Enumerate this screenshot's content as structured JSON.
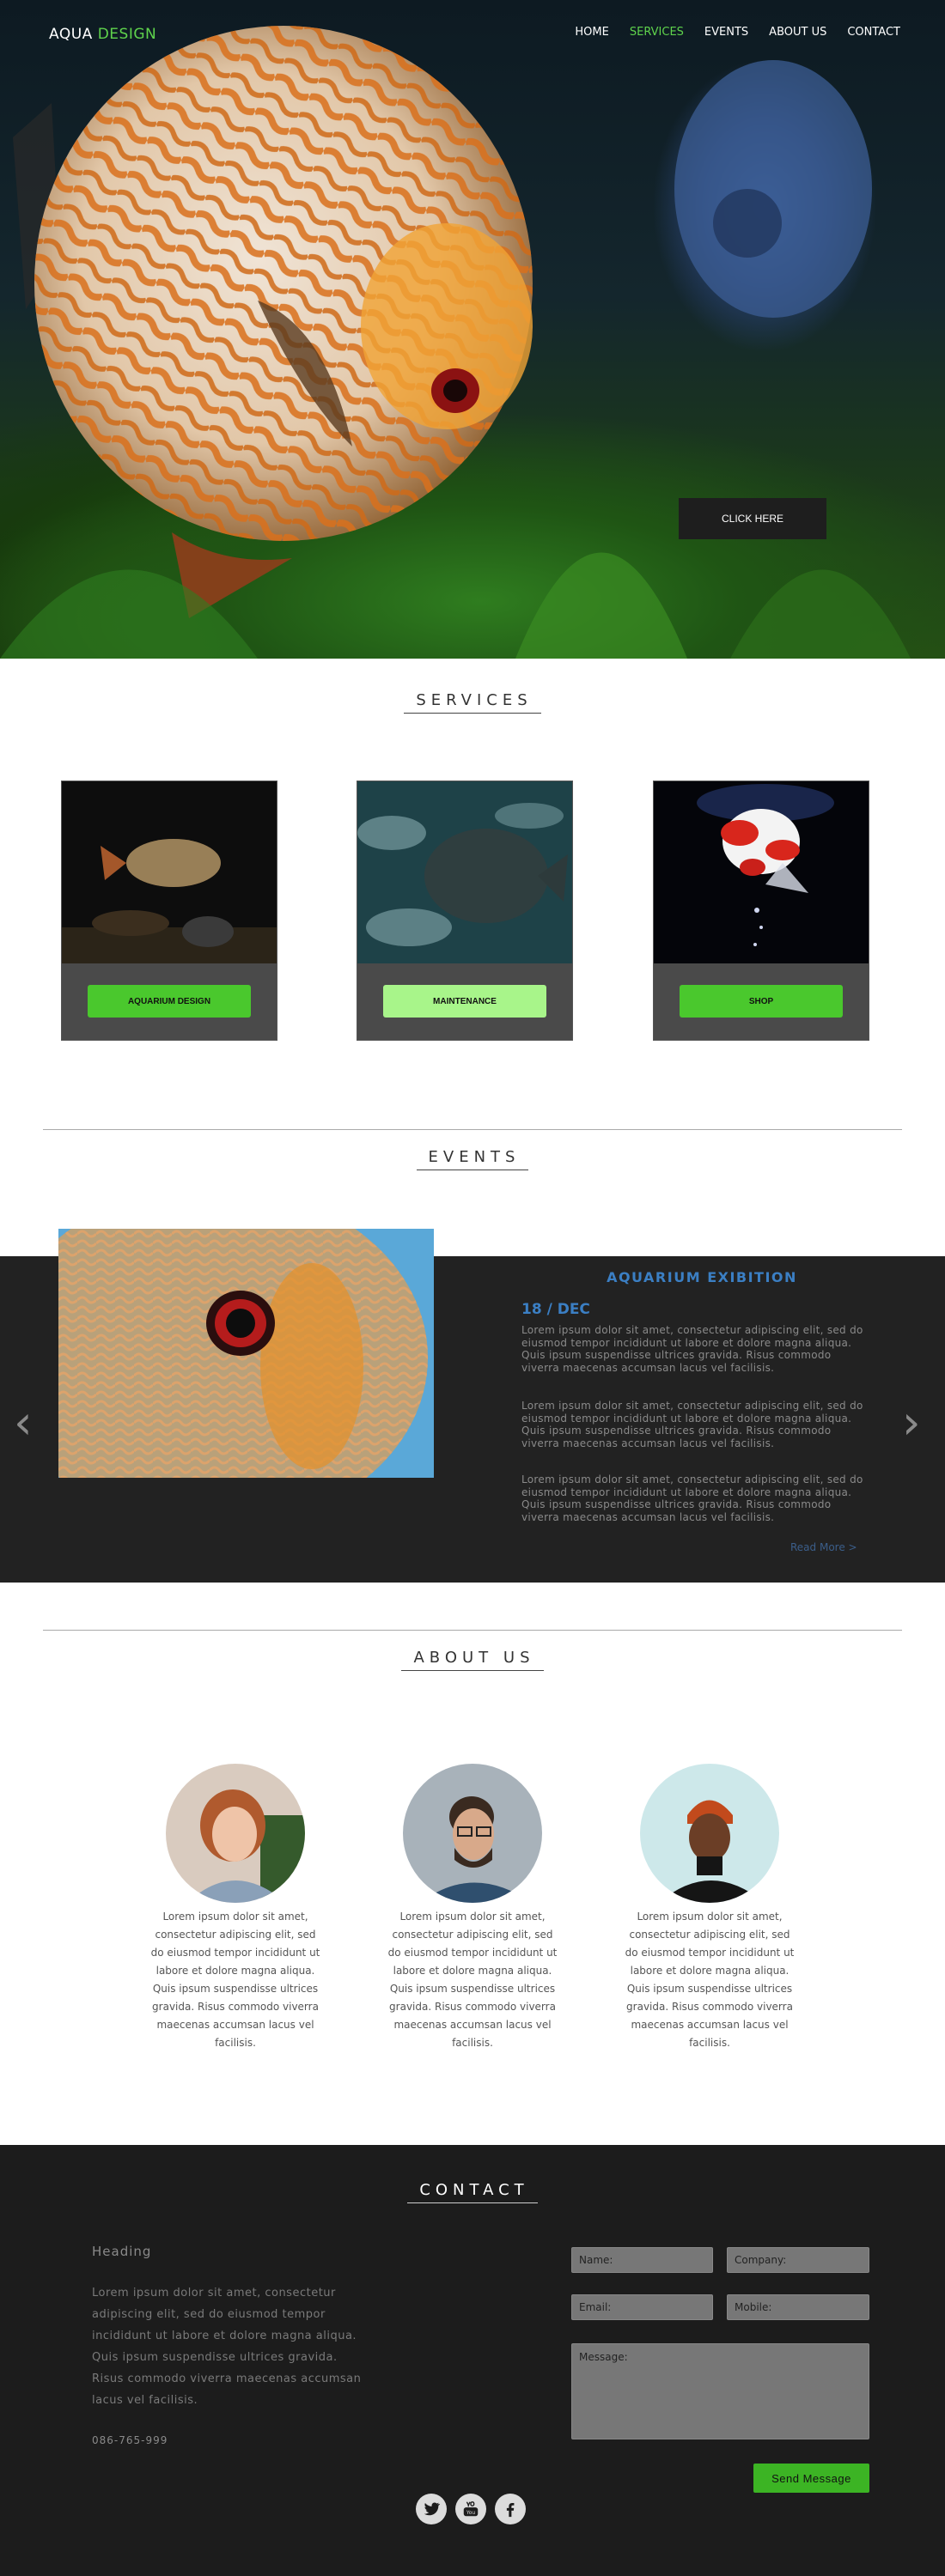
{
  "nav": {
    "logo_main": "AQUA",
    "logo_accent": "DESIGN",
    "items": [
      {
        "label": "HOME"
      },
      {
        "label": "SERVICES",
        "active": true
      },
      {
        "label": "EVENTS"
      },
      {
        "label": "ABOUT US"
      },
      {
        "label": "CONTACT"
      }
    ]
  },
  "hero": {
    "button_label": "CLICK HERE"
  },
  "services": {
    "title": "SERVICES",
    "cards": [
      {
        "button": "AQUARIUM DESIGN"
      },
      {
        "button": "MAINTENANCE"
      },
      {
        "button": "SHOP"
      }
    ]
  },
  "events": {
    "title": "EVENTS",
    "event_title": "AQUARIUM EXIBITION",
    "date": "18 / DEC",
    "paragraphs": [
      "Lorem ipsum dolor sit amet, consectetur adipiscing elit, sed do eiusmod tempor incididunt ut labore et dolore magna aliqua. Quis ipsum suspendisse ultrices gravida. Risus commodo viverra maecenas accumsan lacus vel facilisis.",
      "Lorem ipsum dolor sit amet, consectetur adipiscing elit, sed do eiusmod tempor incididunt ut labore et dolore magna aliqua. Quis ipsum suspendisse ultrices gravida. Risus commodo viverra maecenas accumsan lacus vel facilisis.",
      "Lorem ipsum dolor sit amet, consectetur adipiscing elit, sed do eiusmod tempor incididunt ut labore et dolore magna aliqua. Quis ipsum suspendisse ultrices gravida. Risus commodo viverra maecenas accumsan lacus vel facilisis."
    ],
    "read_more": "Read More  >",
    "prev_arrow": "‹",
    "next_arrow": "›"
  },
  "about": {
    "title": "ABOUT US",
    "bios": [
      "Lorem ipsum dolor sit amet, consectetur adipiscing elit, sed do eiusmod tempor incididunt ut labore et dolore magna aliqua. Quis ipsum suspendisse ultrices gravida. Risus commodo viverra maecenas accumsan lacus vel facilisis.",
      "Lorem ipsum dolor sit amet, consectetur adipiscing elit, sed do eiusmod tempor incididunt ut labore et dolore magna aliqua. Quis ipsum suspendisse ultrices gravida. Risus commodo viverra maecenas accumsan lacus vel facilisis.",
      "Lorem ipsum dolor sit amet, consectetur adipiscing elit, sed do eiusmod tempor incididunt ut labore et dolore magna aliqua. Quis ipsum suspendisse ultrices gravida. Risus commodo viverra maecenas accumsan lacus vel facilisis."
    ]
  },
  "contact": {
    "title": "CONTACT",
    "heading": "Heading",
    "text": "Lorem ipsum dolor sit amet, consectetur adipiscing elit, sed do eiusmod tempor incididunt ut labore et dolore magna aliqua. Quis ipsum suspendisse ultrices gravida. Risus commodo viverra maecenas accumsan lacus vel facilisis.",
    "phone": "086-765-999",
    "name_placeholder": "Name:",
    "company_placeholder": "Company:",
    "email_placeholder": "Email:",
    "mobile_placeholder": "Mobile:",
    "message_placeholder": "Message:",
    "send_label": "Send Message",
    "social": [
      "twitter-icon",
      "youtube-icon",
      "facebook-icon"
    ]
  },
  "colors": {
    "accent_green": "#4ac82d",
    "accent_blue": "#3b7fc4",
    "dark_band": "#222222"
  }
}
